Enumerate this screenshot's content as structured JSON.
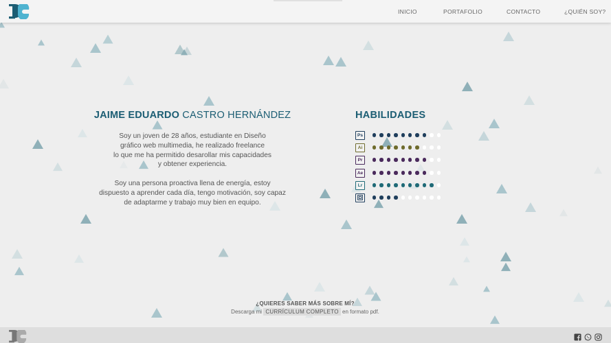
{
  "colors": {
    "brand_dark": "#1b5d73",
    "brand_light": "#4fb3d0",
    "page_bg": "#eeeeee"
  },
  "nav": {
    "items": [
      "INICIO",
      "PORTAFOLIO",
      "CONTACTO",
      "¿QUIÉN SOY?"
    ]
  },
  "about": {
    "name_first": "JAIME EDUARDO",
    "name_last": "CASTRO HERNÁNDEZ",
    "paragraph1": [
      "Soy un joven de 28 años, estudiante en Diseño",
      "gráfico web multimedia, he realizado freelance",
      "lo que me ha permitido desarollar mis capacidades",
      "y obtener experiencia."
    ],
    "paragraph2": [
      "Soy una persona proactiva llena de energía, estoy",
      "dispuesto a aprender cada día, tengo motivación, soy capaz",
      "de adaptarme y trabajo muy bien en equipo."
    ]
  },
  "skills": {
    "title": "HABILIDADES",
    "items": [
      {
        "abbr": "Ps",
        "icon": "photoshop-icon",
        "level": 8,
        "max": 10,
        "color": "#1f3e5c"
      },
      {
        "abbr": "Ai",
        "icon": "illustrator-icon",
        "level": 7,
        "max": 10,
        "color": "#6e6b2c"
      },
      {
        "abbr": "Pr",
        "icon": "premiere-icon",
        "level": 8,
        "max": 10,
        "color": "#4a2a5c"
      },
      {
        "abbr": "Ae",
        "icon": "after-effects-icon",
        "level": 8,
        "max": 10,
        "color": "#4a2a5c"
      },
      {
        "abbr": "Lr",
        "icon": "lightroom-icon",
        "level": 9,
        "max": 10,
        "color": "#1f6a77"
      },
      {
        "abbr": "",
        "icon": "indesign-icon",
        "level": 4,
        "max": 10,
        "color": "#1f3e5c"
      }
    ]
  },
  "cta": {
    "question": "¿QUIERES SABER MÁS SOBRE MÍ?",
    "prefix": "Descarga mi",
    "link": "CURRÍCULUM COMPLETO",
    "suffix": "en formato pdf."
  },
  "footer": {
    "social_icons": [
      "facebook-icon",
      "whatsapp-icon",
      "instagram-icon"
    ]
  }
}
